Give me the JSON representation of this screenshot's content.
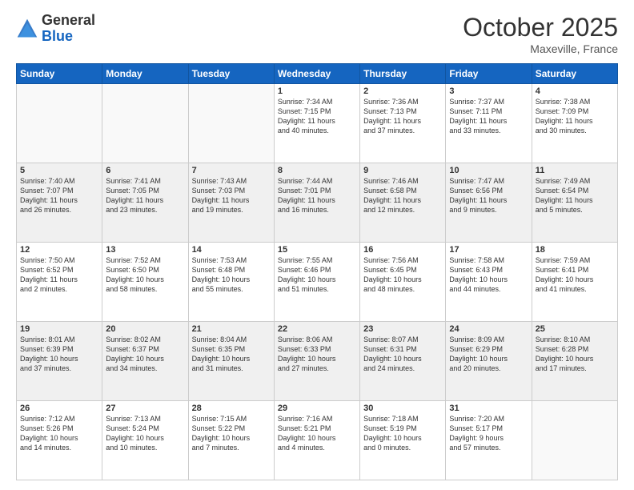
{
  "header": {
    "logo_general": "General",
    "logo_blue": "Blue",
    "month": "October 2025",
    "location": "Maxeville, France"
  },
  "days_of_week": [
    "Sunday",
    "Monday",
    "Tuesday",
    "Wednesday",
    "Thursday",
    "Friday",
    "Saturday"
  ],
  "weeks": [
    [
      {
        "day": "",
        "info": ""
      },
      {
        "day": "",
        "info": ""
      },
      {
        "day": "",
        "info": ""
      },
      {
        "day": "1",
        "info": "Sunrise: 7:34 AM\nSunset: 7:15 PM\nDaylight: 11 hours\nand 40 minutes."
      },
      {
        "day": "2",
        "info": "Sunrise: 7:36 AM\nSunset: 7:13 PM\nDaylight: 11 hours\nand 37 minutes."
      },
      {
        "day": "3",
        "info": "Sunrise: 7:37 AM\nSunset: 7:11 PM\nDaylight: 11 hours\nand 33 minutes."
      },
      {
        "day": "4",
        "info": "Sunrise: 7:38 AM\nSunset: 7:09 PM\nDaylight: 11 hours\nand 30 minutes."
      }
    ],
    [
      {
        "day": "5",
        "info": "Sunrise: 7:40 AM\nSunset: 7:07 PM\nDaylight: 11 hours\nand 26 minutes."
      },
      {
        "day": "6",
        "info": "Sunrise: 7:41 AM\nSunset: 7:05 PM\nDaylight: 11 hours\nand 23 minutes."
      },
      {
        "day": "7",
        "info": "Sunrise: 7:43 AM\nSunset: 7:03 PM\nDaylight: 11 hours\nand 19 minutes."
      },
      {
        "day": "8",
        "info": "Sunrise: 7:44 AM\nSunset: 7:01 PM\nDaylight: 11 hours\nand 16 minutes."
      },
      {
        "day": "9",
        "info": "Sunrise: 7:46 AM\nSunset: 6:58 PM\nDaylight: 11 hours\nand 12 minutes."
      },
      {
        "day": "10",
        "info": "Sunrise: 7:47 AM\nSunset: 6:56 PM\nDaylight: 11 hours\nand 9 minutes."
      },
      {
        "day": "11",
        "info": "Sunrise: 7:49 AM\nSunset: 6:54 PM\nDaylight: 11 hours\nand 5 minutes."
      }
    ],
    [
      {
        "day": "12",
        "info": "Sunrise: 7:50 AM\nSunset: 6:52 PM\nDaylight: 11 hours\nand 2 minutes."
      },
      {
        "day": "13",
        "info": "Sunrise: 7:52 AM\nSunset: 6:50 PM\nDaylight: 10 hours\nand 58 minutes."
      },
      {
        "day": "14",
        "info": "Sunrise: 7:53 AM\nSunset: 6:48 PM\nDaylight: 10 hours\nand 55 minutes."
      },
      {
        "day": "15",
        "info": "Sunrise: 7:55 AM\nSunset: 6:46 PM\nDaylight: 10 hours\nand 51 minutes."
      },
      {
        "day": "16",
        "info": "Sunrise: 7:56 AM\nSunset: 6:45 PM\nDaylight: 10 hours\nand 48 minutes."
      },
      {
        "day": "17",
        "info": "Sunrise: 7:58 AM\nSunset: 6:43 PM\nDaylight: 10 hours\nand 44 minutes."
      },
      {
        "day": "18",
        "info": "Sunrise: 7:59 AM\nSunset: 6:41 PM\nDaylight: 10 hours\nand 41 minutes."
      }
    ],
    [
      {
        "day": "19",
        "info": "Sunrise: 8:01 AM\nSunset: 6:39 PM\nDaylight: 10 hours\nand 37 minutes."
      },
      {
        "day": "20",
        "info": "Sunrise: 8:02 AM\nSunset: 6:37 PM\nDaylight: 10 hours\nand 34 minutes."
      },
      {
        "day": "21",
        "info": "Sunrise: 8:04 AM\nSunset: 6:35 PM\nDaylight: 10 hours\nand 31 minutes."
      },
      {
        "day": "22",
        "info": "Sunrise: 8:06 AM\nSunset: 6:33 PM\nDaylight: 10 hours\nand 27 minutes."
      },
      {
        "day": "23",
        "info": "Sunrise: 8:07 AM\nSunset: 6:31 PM\nDaylight: 10 hours\nand 24 minutes."
      },
      {
        "day": "24",
        "info": "Sunrise: 8:09 AM\nSunset: 6:29 PM\nDaylight: 10 hours\nand 20 minutes."
      },
      {
        "day": "25",
        "info": "Sunrise: 8:10 AM\nSunset: 6:28 PM\nDaylight: 10 hours\nand 17 minutes."
      }
    ],
    [
      {
        "day": "26",
        "info": "Sunrise: 7:12 AM\nSunset: 5:26 PM\nDaylight: 10 hours\nand 14 minutes."
      },
      {
        "day": "27",
        "info": "Sunrise: 7:13 AM\nSunset: 5:24 PM\nDaylight: 10 hours\nand 10 minutes."
      },
      {
        "day": "28",
        "info": "Sunrise: 7:15 AM\nSunset: 5:22 PM\nDaylight: 10 hours\nand 7 minutes."
      },
      {
        "day": "29",
        "info": "Sunrise: 7:16 AM\nSunset: 5:21 PM\nDaylight: 10 hours\nand 4 minutes."
      },
      {
        "day": "30",
        "info": "Sunrise: 7:18 AM\nSunset: 5:19 PM\nDaylight: 10 hours\nand 0 minutes."
      },
      {
        "day": "31",
        "info": "Sunrise: 7:20 AM\nSunset: 5:17 PM\nDaylight: 9 hours\nand 57 minutes."
      },
      {
        "day": "",
        "info": ""
      }
    ]
  ]
}
